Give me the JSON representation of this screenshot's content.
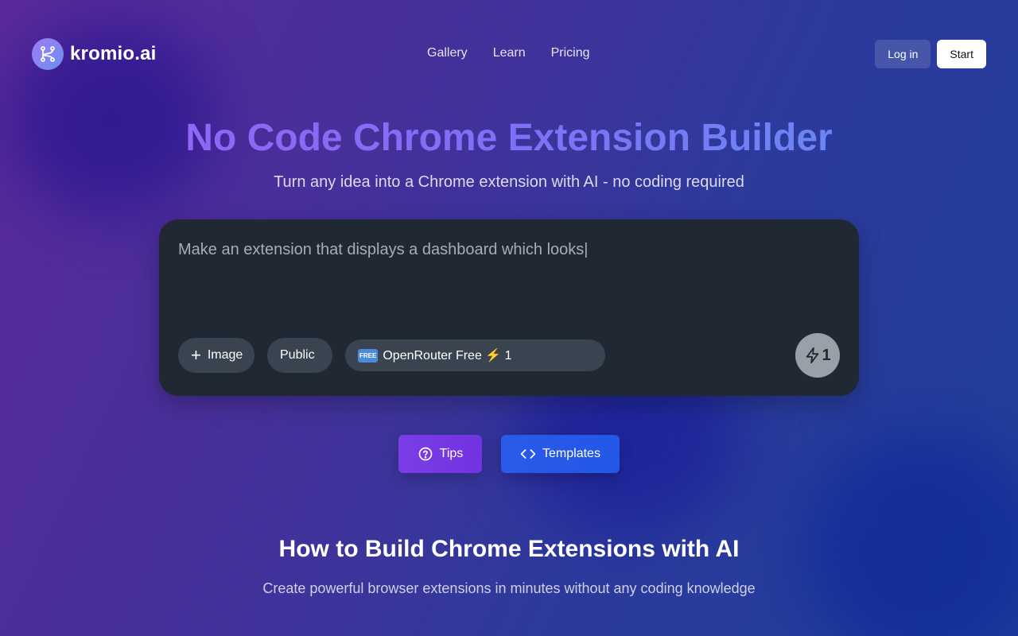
{
  "brand": {
    "name": "kromio.ai",
    "icon": "git-branch-k-icon"
  },
  "nav": {
    "items": [
      "Gallery",
      "Learn",
      "Pricing"
    ]
  },
  "auth": {
    "login_label": "Log in",
    "start_label": "Start"
  },
  "hero": {
    "title": "No Code Chrome Extension Builder",
    "subtitle": "Turn any idea into a Chrome extension with AI - no coding required"
  },
  "prompt": {
    "value": "Make an extension that displays a dashboard which looks|",
    "image_label": "Image",
    "visibility_label": "Public",
    "model": {
      "badge": "FREE",
      "label": "OpenRouter Free ⚡ 1"
    },
    "submit_count": "1"
  },
  "actions": {
    "tips_label": "Tips",
    "templates_label": "Templates"
  },
  "section": {
    "title": "How to Build Chrome Extensions with AI",
    "subtitle": "Create powerful browser extensions in minutes without any coding knowledge"
  },
  "colors": {
    "tips_button": "#7233e0",
    "templates_button": "#2357e6",
    "card_bg": "#1f2833",
    "title_gradient_start": "#9166f4",
    "title_gradient_end": "#6a86f4"
  }
}
